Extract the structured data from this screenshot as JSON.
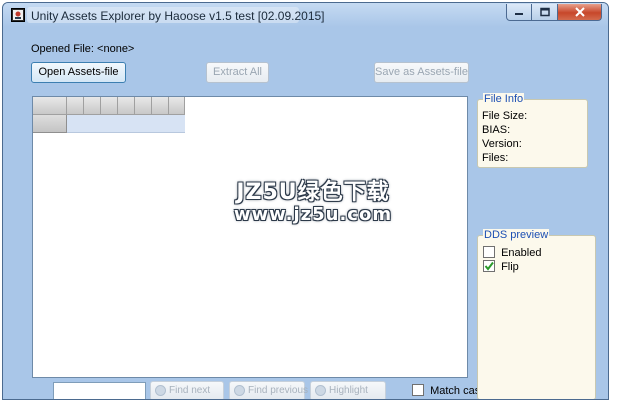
{
  "window": {
    "title": "Unity Assets Explorer by Haoose v1.5 test [02.09.2015]"
  },
  "file": {
    "opened_label": "Opened File: <none>"
  },
  "toolbar": {
    "open_label": "Open Assets-file",
    "extract_label": "Extract All",
    "save_label": "Save as Assets-file"
  },
  "search": {
    "value": "",
    "find_next_label": "Find next",
    "find_previous_label": "Find previous",
    "highlight_label": "Highlight",
    "match_case_label": "Match case"
  },
  "file_info": {
    "title": "File Info",
    "size_label": "File Size:",
    "bias_label": "BIAS:",
    "version_label": "Version:",
    "files_label": "Files:"
  },
  "dds_preview": {
    "title": "DDS preview",
    "enabled_label": "Enabled",
    "enabled_checked": false,
    "flip_label": "Flip",
    "flip_checked": true
  },
  "watermark": {
    "line1": "JZ5U绿色下载",
    "line2": "www.jz5u.com"
  },
  "colors": {
    "window_bg": "#a9c6e8",
    "group_bg": "#fcf9ec",
    "group_title": "#1c4fb3",
    "close_button": "#c7472a"
  },
  "icons": {
    "app": "app-icon",
    "minimize": "minimize-icon",
    "maximize": "maximize-icon",
    "close": "close-icon",
    "check": "check-icon"
  }
}
